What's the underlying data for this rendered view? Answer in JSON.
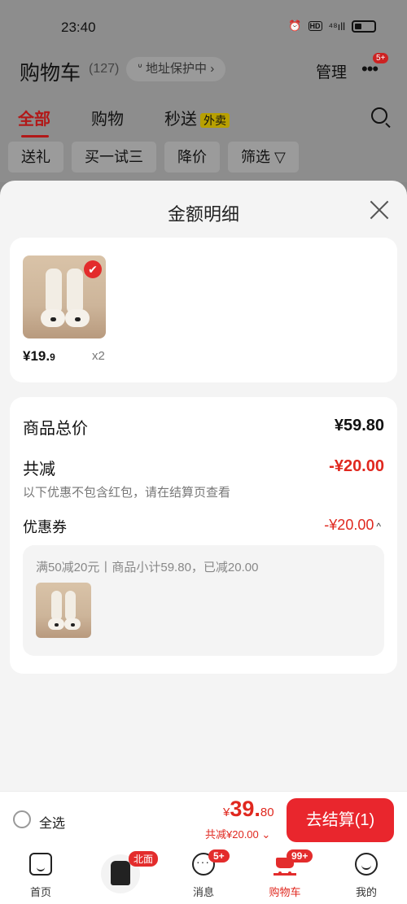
{
  "status_bar": {
    "time": "23:40",
    "network": "⁴⁸ıll"
  },
  "cart_header": {
    "title": "购物车",
    "count": "(127)",
    "address": "地址保护中",
    "manage": "管理",
    "more_badge": "5+"
  },
  "tabs": [
    {
      "label": "全部"
    },
    {
      "label": "购物"
    },
    {
      "label": "秒送",
      "tag": "外卖"
    }
  ],
  "chips": [
    "送礼",
    "买一试三",
    "降价",
    "筛选"
  ],
  "sheet": {
    "title": "金额明细",
    "product": {
      "price_main": "¥19.",
      "price_dec": "9",
      "qty": "x2"
    },
    "summary": {
      "total_label": "商品总价",
      "total_value": "¥59.80",
      "discount_label": "共减",
      "discount_value": "-¥20.00",
      "note": "以下优惠不包含红包，请在结算页查看",
      "coupon_label": "优惠券",
      "coupon_value": "-¥20.00",
      "coupon_desc": "满50减20元丨商品小计59.80，已减20.00"
    }
  },
  "checkout": {
    "select_all": "全选",
    "currency": "¥",
    "total_int": "39.",
    "total_dec": "80",
    "saved": "共减¥20.00",
    "button": "去结算(1)"
  },
  "bottom_nav": {
    "home": "首页",
    "promo_tag": "北面",
    "messages": "消息",
    "messages_badge": "5+",
    "cart": "购物车",
    "cart_badge": "99+",
    "me": "我的"
  },
  "colors": {
    "accent": "#e9262d",
    "dark_red": "#b21818",
    "sheet_bg": "#f4f4f4"
  }
}
